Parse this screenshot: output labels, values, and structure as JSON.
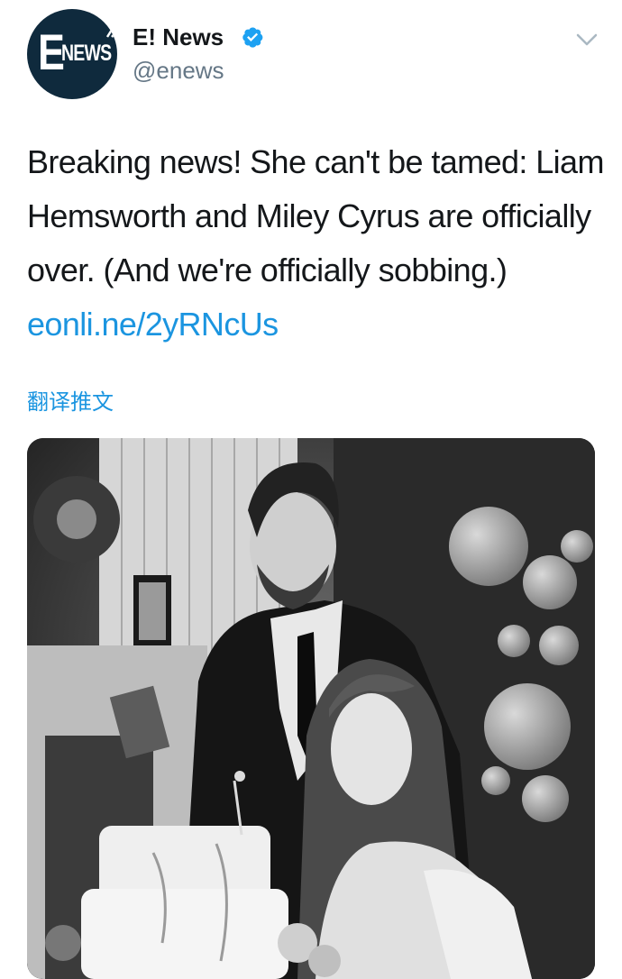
{
  "tweet": {
    "author": {
      "display_name": "E! News",
      "handle": "@enews",
      "verified": true,
      "avatar": {
        "logo_text_letter": "E",
        "logo_text_word": "NEWS"
      }
    },
    "text": "Breaking news! She can't be tamed: Liam Hemsworth and Miley Cyrus are officially over. (And we're officially sobbing.) ",
    "link": "eonli.ne/2yRNcUs",
    "translate_label": "翻译推文",
    "media": {
      "icon": "photo"
    }
  },
  "colors": {
    "link": "#1b95e0",
    "verified": "#1da1f2",
    "handle": "#657786",
    "text": "#14171a"
  }
}
